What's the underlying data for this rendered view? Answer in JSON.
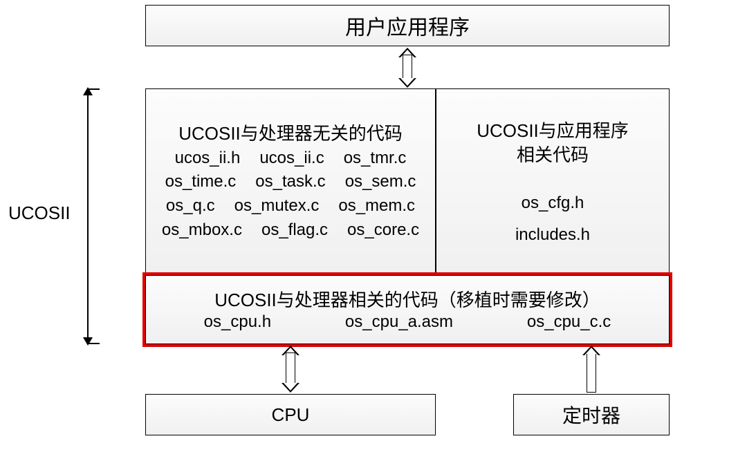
{
  "userApp": {
    "title": "用户应用程序"
  },
  "ucosiiLabel": "UCOSII",
  "procIndependent": {
    "title": "UCOSII与处理器无关的代码",
    "files": [
      "ucos_ii.h",
      "ucos_ii.c",
      "os_tmr.c",
      "os_time.c",
      "os_task.c",
      "os_sem.c",
      "os_q.c",
      "os_mutex.c",
      "os_mem.c",
      "os_mbox.c",
      "os_flag.c",
      "os_core.c"
    ]
  },
  "appRelated": {
    "titleLine1": "UCOSII与应用程序",
    "titleLine2": "相关代码",
    "files": [
      "os_cfg.h",
      "includes.h"
    ]
  },
  "procDependent": {
    "title": "UCOSII与处理器相关的代码（移植时需要修改）",
    "files": [
      "os_cpu.h",
      "os_cpu_a.asm",
      "os_cpu_c.c"
    ]
  },
  "cpu": {
    "label": "CPU"
  },
  "timer": {
    "label": "定时器"
  }
}
